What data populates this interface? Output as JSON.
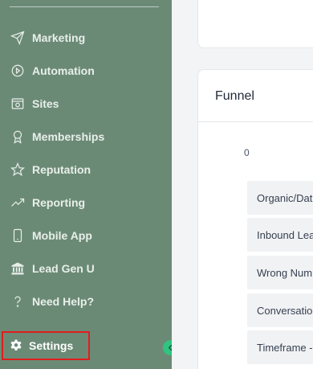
{
  "sidebar": {
    "items": [
      {
        "label": "Marketing",
        "icon": "send-icon"
      },
      {
        "label": "Automation",
        "icon": "automation-icon"
      },
      {
        "label": "Sites",
        "icon": "globe-window-icon"
      },
      {
        "label": "Memberships",
        "icon": "award-icon"
      },
      {
        "label": "Reputation",
        "icon": "star-icon"
      },
      {
        "label": "Reporting",
        "icon": "trend-up-icon"
      },
      {
        "label": "Mobile App",
        "icon": "phone-icon"
      },
      {
        "label": "Lead Gen U",
        "icon": "bank-icon"
      },
      {
        "label": "Need Help?",
        "icon": "question-icon"
      }
    ],
    "settings_label": "Settings"
  },
  "main": {
    "funnel": {
      "title": "Funnel",
      "zero_label": "0",
      "rows": [
        "Organic/Dat",
        "Inbound Lea",
        "Wrong Num",
        "Conversatio",
        "Timeframe -"
      ]
    }
  },
  "colors": {
    "sidebar_bg": "#6b8a76",
    "highlight_border": "#e11d1d",
    "collapse_button": "#2fc47f"
  }
}
